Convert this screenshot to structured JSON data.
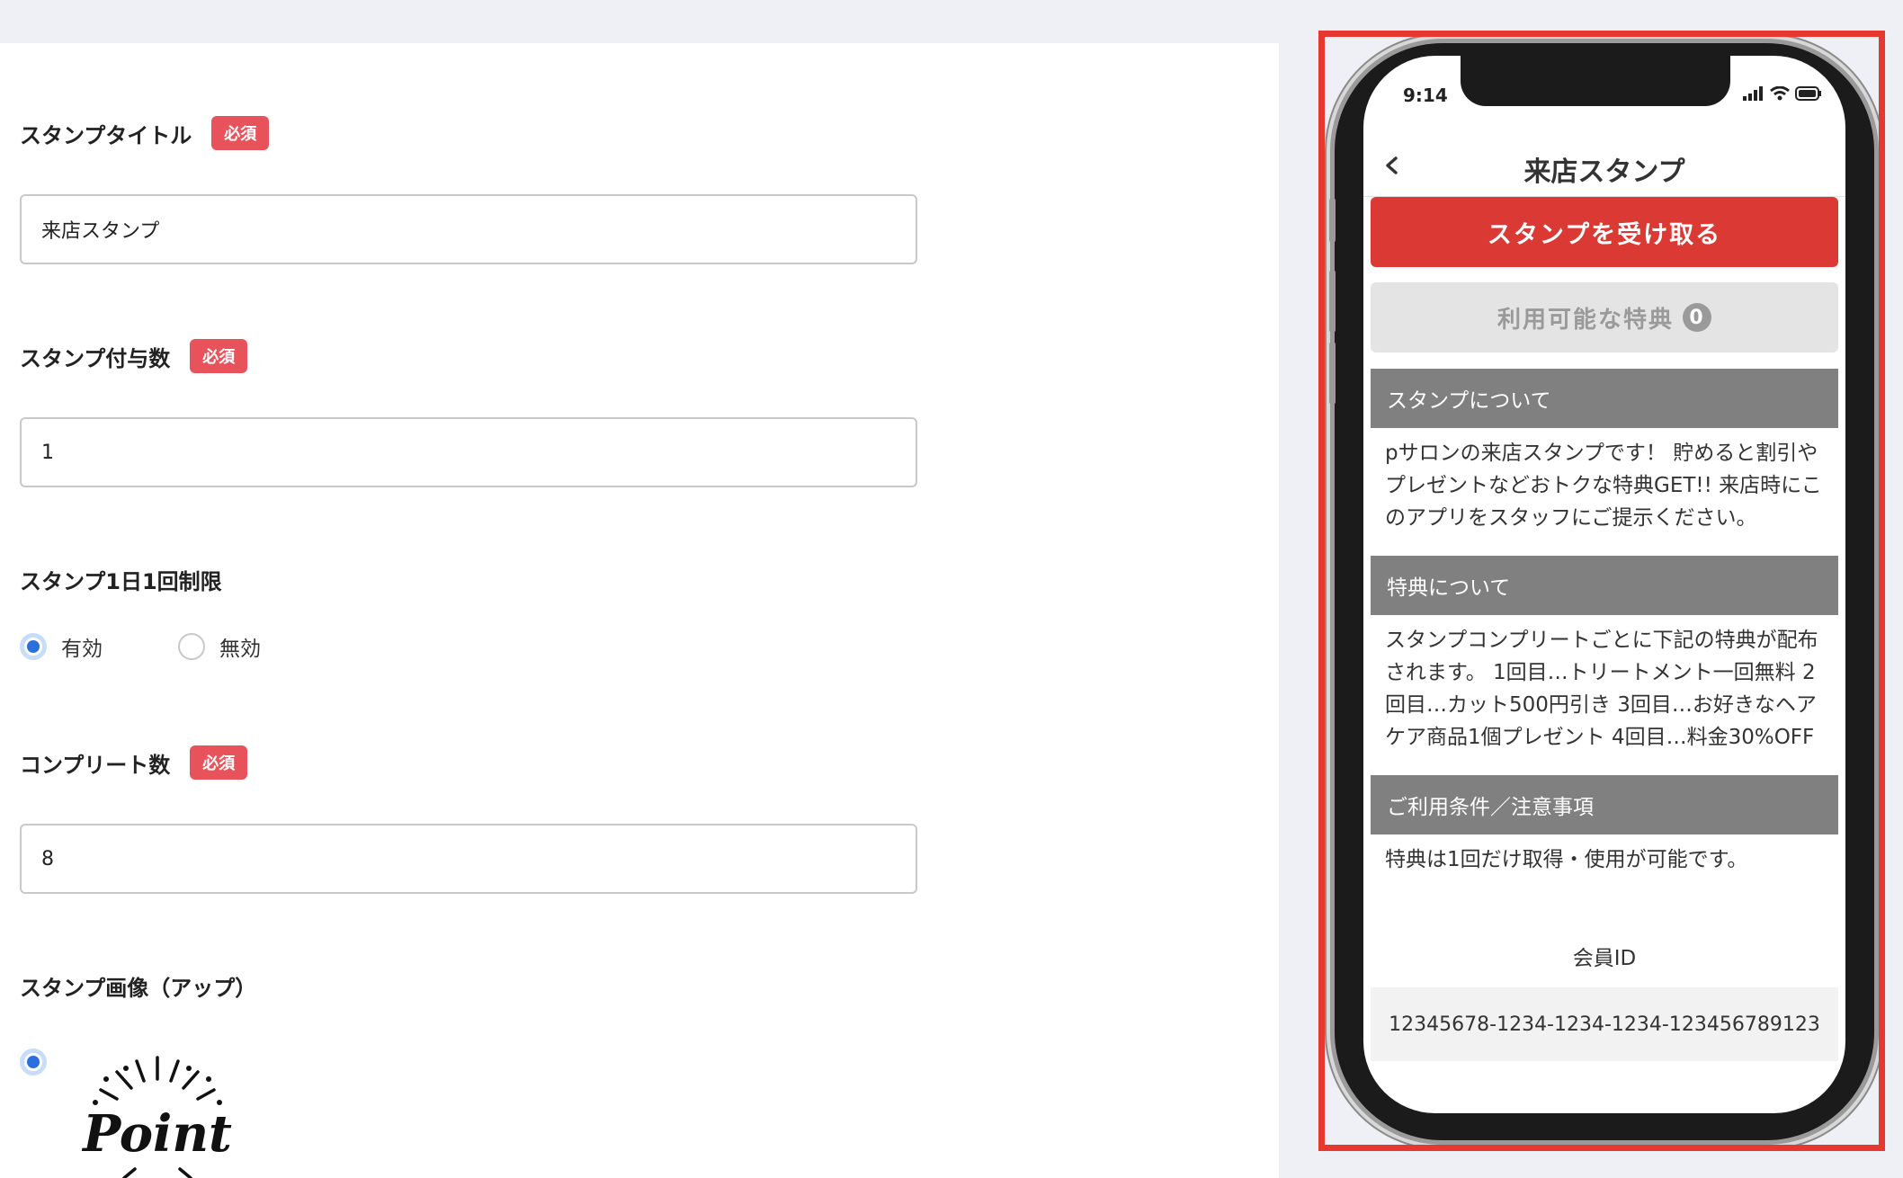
{
  "form": {
    "stamp_title": {
      "label": "スタンプタイトル",
      "badge": "必須",
      "value": "来店スタンプ"
    },
    "stamp_grant": {
      "label": "スタンプ付与数",
      "badge": "必須",
      "value": "1"
    },
    "daily_limit": {
      "label": "スタンプ1日1回制限",
      "options": [
        "有効",
        "無効"
      ],
      "selected": "有効"
    },
    "complete_count": {
      "label": "コンプリート数",
      "badge": "必須",
      "value": "8"
    },
    "stamp_image": {
      "label": "スタンプ画像（アップ）",
      "logo_text": "Point"
    }
  },
  "preview": {
    "status_time": "9:14",
    "nav_title": "来店スタンプ",
    "receive_button": "スタンプを受け取る",
    "benefits_button": "利用可能な特典",
    "benefits_count": "0",
    "sections": [
      {
        "heading": "スタンプについて",
        "body": "pサロンの来店スタンプです！ 貯めると割引やプレゼントなどおトクな特典GET!! 来店時にこのアプリをスタッフにご提示ください。"
      },
      {
        "heading": "特典について",
        "body": "スタンプコンプリートごとに下記の特典が配布されます。 1回目…トリートメント一回無料 2回目…カット500円引き 3回目…お好きなヘアケア商品1個プレゼント 4回目…料金30%OFF"
      },
      {
        "heading": "ご利用条件／注意事項",
        "body": "特典は1回だけ取得・使用が可能です。"
      }
    ],
    "member_label": "会員ID",
    "member_id": "12345678-1234-1234-1234-123456789123"
  },
  "colors": {
    "required_badge": "#e8525a",
    "radio_accent": "#2a6fdb",
    "preview_border": "#e6382f",
    "primary_button": "#db3a34",
    "section_heading": "#808080"
  }
}
